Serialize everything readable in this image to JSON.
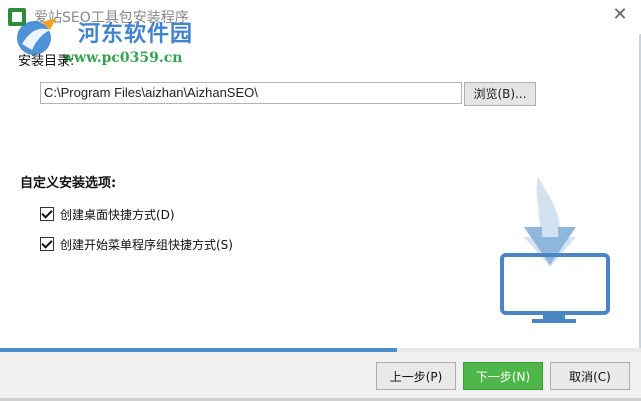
{
  "window": {
    "title": "爱站SEO工具包安装程序",
    "close_glyph": "✕"
  },
  "watermark": {
    "main": "河东软件园",
    "url": "www.pc0359.cn"
  },
  "install_dir": {
    "label": "安装目录:",
    "value": "C:\\Program Files\\aizhan\\AizhanSEO\\",
    "browse_label": "浏览(B)..."
  },
  "custom": {
    "title": "自定义安装选项:",
    "options": [
      {
        "label": "创建桌面快捷方式(D)",
        "checked": true
      },
      {
        "label": "创建开始菜单程序组快捷方式(S)",
        "checked": true
      }
    ]
  },
  "progress": {
    "fraction": 0.62,
    "color": "#4a8fcb"
  },
  "footer": {
    "prev_label": "上一步(P)",
    "next_label": "下一步(N)",
    "cancel_label": "取消(C)"
  },
  "colors": {
    "accent_blue": "#4a8fcb",
    "next_green": "#4fb64a"
  }
}
